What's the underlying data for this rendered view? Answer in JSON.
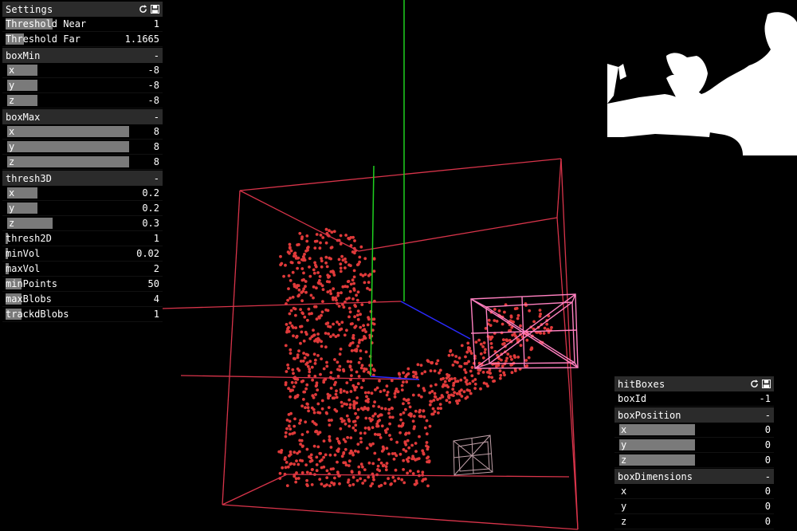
{
  "settings": {
    "title": "Settings",
    "threshold_near": {
      "label": "Threshold Near",
      "value": "1",
      "fill": 0.3
    },
    "threshold_far": {
      "label": "Threshold Far",
      "value": "1.1665",
      "fill": 0.12
    },
    "boxMin": {
      "title": "boxMin",
      "collapse": "-",
      "x": {
        "label": "x",
        "value": "-8",
        "fill": 0.2
      },
      "y": {
        "label": "y",
        "value": "-8",
        "fill": 0.2
      },
      "z": {
        "label": "z",
        "value": "-8",
        "fill": 0.2
      }
    },
    "boxMax": {
      "title": "boxMax",
      "collapse": "-",
      "x": {
        "label": "x",
        "value": "8",
        "fill": 0.8
      },
      "y": {
        "label": "y",
        "value": "8",
        "fill": 0.8
      },
      "z": {
        "label": "z",
        "value": "8",
        "fill": 0.8
      }
    },
    "thresh3D": {
      "title": "thresh3D",
      "collapse": "-",
      "x": {
        "label": "x",
        "value": "0.2",
        "fill": 0.2
      },
      "y": {
        "label": "y",
        "value": "0.2",
        "fill": 0.2
      },
      "z": {
        "label": "z",
        "value": "0.3",
        "fill": 0.3
      }
    },
    "thresh2D": {
      "label": "thresh2D",
      "value": "1",
      "fill": 0.0
    },
    "minVol": {
      "label": "minVol",
      "value": "0.02",
      "fill": 0.0
    },
    "maxVol": {
      "label": "maxVol",
      "value": "2",
      "fill": 0.02
    },
    "minPoints": {
      "label": "minPoints",
      "value": "50",
      "fill": 0.1
    },
    "maxBlobs": {
      "label": "maxBlobs",
      "value": "4",
      "fill": 0.1
    },
    "trackdBlobs": {
      "label": "trackdBlobs",
      "value": "1",
      "fill": 0.1
    }
  },
  "hitBoxes": {
    "title": "hitBoxes",
    "boxId": {
      "label": "boxId",
      "value": "-1"
    },
    "boxPosition": {
      "title": "boxPosition",
      "collapse": "-",
      "x": {
        "label": "x",
        "value": "0",
        "fill": 0.5
      },
      "y": {
        "label": "y",
        "value": "0",
        "fill": 0.5
      },
      "z": {
        "label": "z",
        "value": "0",
        "fill": 0.5
      }
    },
    "boxDimensions": {
      "title": "boxDimensions",
      "collapse": "-",
      "x": {
        "label": "x",
        "value": "0",
        "fill": 0.0
      },
      "y": {
        "label": "y",
        "value": "0",
        "fill": 0.0
      },
      "z": {
        "label": "z",
        "value": "0",
        "fill": 0.0
      }
    }
  },
  "icons": {
    "reset": "refresh-icon",
    "save": "save-icon"
  },
  "colors": {
    "point_cloud": "#e03a3a",
    "bbox": "#d8344a",
    "hitbox": "#ff80c0",
    "axis_y": "#1fd01f",
    "axis_z": "#2a2aff",
    "axis_x": "#d8344a",
    "small_box": "#c0a0a8"
  }
}
